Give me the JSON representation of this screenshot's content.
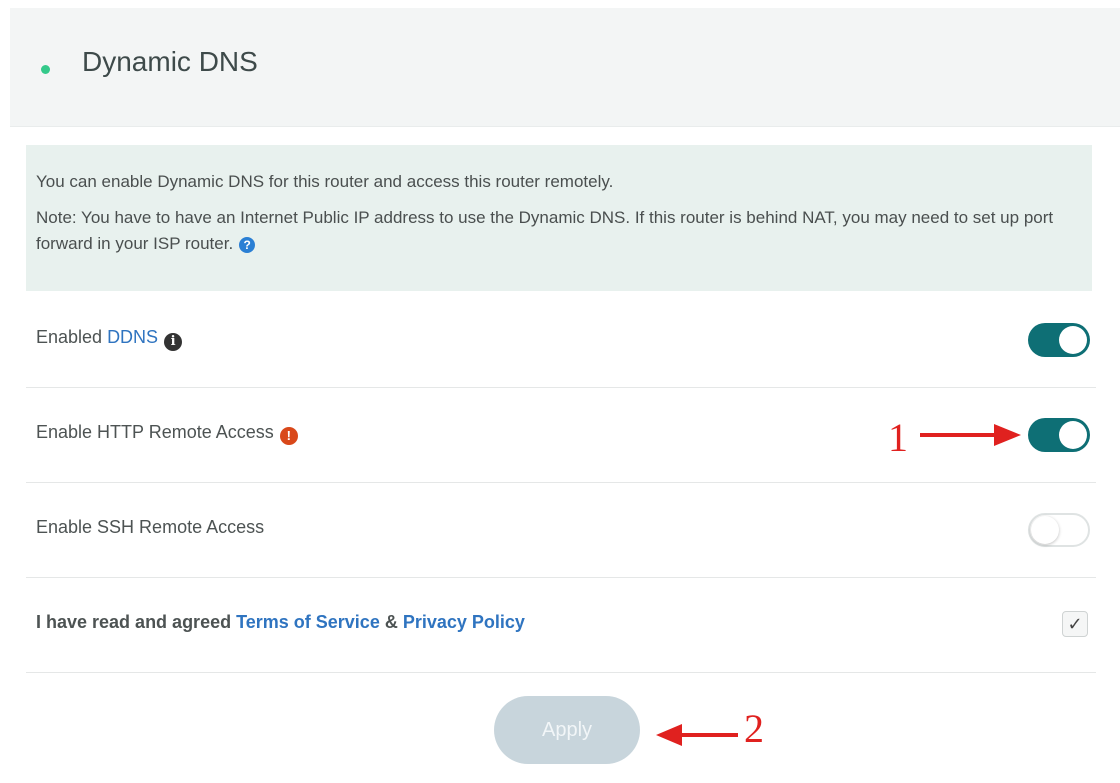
{
  "page": {
    "top_partial_text": "",
    "section_title": "Dynamic DNS"
  },
  "notice": {
    "line1": "You can enable Dynamic DNS for this router and access this router remotely.",
    "line2": "Note: You have to have an Internet Public IP address to use the Dynamic DNS. If this router is behind NAT, you may need to set up port forward in your ISP router."
  },
  "settings": [
    {
      "label_prefix": "Enabled ",
      "label_link": "DDNS",
      "enabled": true
    },
    {
      "label": "Enable HTTP Remote Access",
      "enabled": true
    },
    {
      "label": "Enable SSH Remote Access",
      "enabled": false
    }
  ],
  "agreement": {
    "prefix": "I have read and agreed ",
    "terms_link": "Terms of Service",
    "amp": " & ",
    "privacy_link": "Privacy Policy",
    "checked": true
  },
  "apply_button": {
    "label": "Apply"
  },
  "annotations": {
    "arrow1_label": "1",
    "arrow2_label": "2"
  },
  "colors": {
    "accent_dot": "#34c98a",
    "toggle_on": "#0e6f75",
    "link": "#2f74c0",
    "annotation_red": "#e0211f",
    "apply_disabled": "#c8d5dc"
  }
}
